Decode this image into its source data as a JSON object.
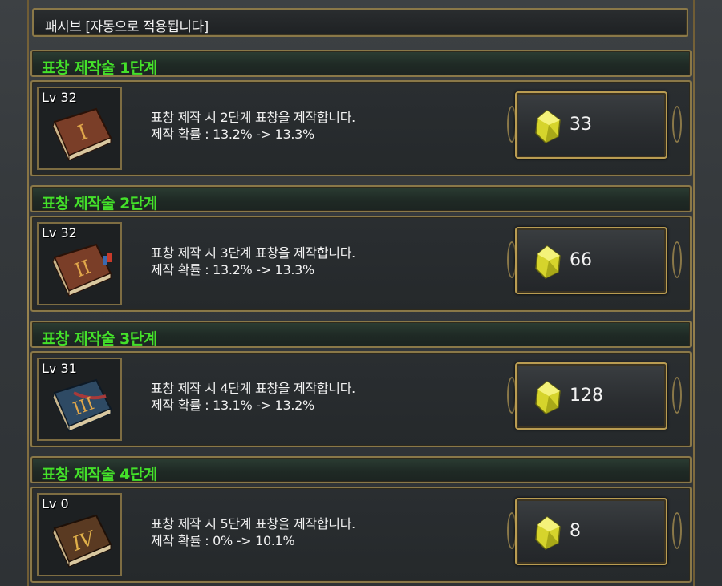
{
  "header": {
    "label": "패시브 [자동으로 적용됩니다]"
  },
  "skills": [
    {
      "title": "표창 제작술 1단계",
      "level": "Lv 32",
      "numeral": "I",
      "book_color": "#7a3e28",
      "desc_line1": "표창 제작 시 2단계 표창을 제작합니다.",
      "desc_line2": "제작 확률 : 13.2% -> 13.3%",
      "cost": "33"
    },
    {
      "title": "표창 제작술 2단계",
      "level": "Lv 32",
      "numeral": "II",
      "book_color": "#7a3e28",
      "desc_line1": "표창 제작 시 3단계 표창을 제작합니다.",
      "desc_line2": "제작 확률 : 13.2% -> 13.3%",
      "cost": "66"
    },
    {
      "title": "표창 제작술 3단계",
      "level": "Lv 31",
      "numeral": "III",
      "book_color": "#2e4a64",
      "desc_line1": "표창 제작 시 4단계 표창을 제작합니다.",
      "desc_line2": "제작 확률 : 13.1% -> 13.2%",
      "cost": "128"
    },
    {
      "title": "표창 제작술 4단계",
      "level": "Lv 0",
      "numeral": "IV",
      "book_color": "#5a3a22",
      "desc_line1": "표창 제작 시 5단계 표창을 제작합니다.",
      "desc_line2": "제작 확률 : 0% -> 10.1%",
      "cost": "8"
    }
  ],
  "colors": {
    "title_green": "#44e12a",
    "gold_border": "#8a7848",
    "gem_yellow": "#e6e43a"
  }
}
